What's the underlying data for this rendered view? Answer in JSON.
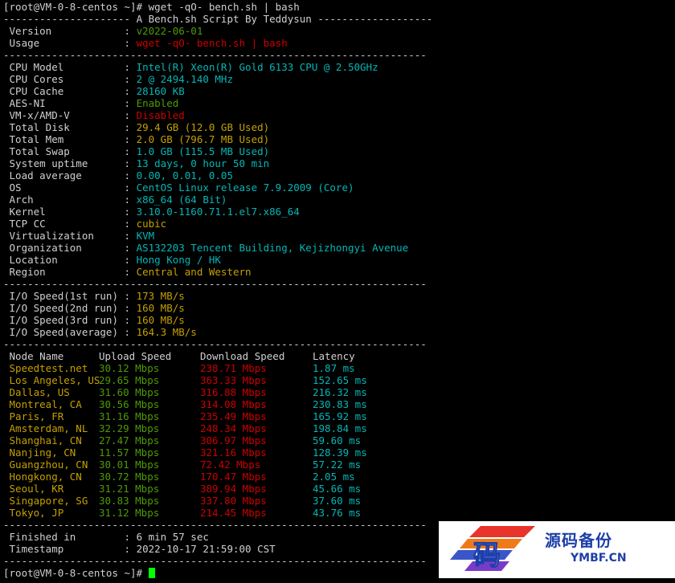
{
  "prompt_cmd": "[root@VM-0-8-centos ~]# wget -qO- bench.sh | bash",
  "divider": "----------------------------------------------------------------------",
  "banner": "--------------------- A Bench.sh Script By Teddysun -------------------",
  "header": [
    {
      "key": " Version            ",
      "sep": ": ",
      "value": "v2022-06-01",
      "color": "g"
    },
    {
      "key": " Usage              ",
      "sep": ": ",
      "value": "wget -qO- bench.sh | bash",
      "color": "r"
    }
  ],
  "sysinfo": [
    {
      "key": " CPU Model          ",
      "sep": ": ",
      "value": "Intel(R) Xeon(R) Gold 6133 CPU @ 2.50GHz",
      "color": "c"
    },
    {
      "key": " CPU Cores          ",
      "sep": ": ",
      "value": "2 @ 2494.140 MHz",
      "color": "c"
    },
    {
      "key": " CPU Cache          ",
      "sep": ": ",
      "value": "28160 KB",
      "color": "c"
    },
    {
      "key": " AES-NI             ",
      "sep": ": ",
      "value": "Enabled",
      "color": "g"
    },
    {
      "key": " VM-x/AMD-V         ",
      "sep": ": ",
      "value": "Disabled",
      "color": "r"
    },
    {
      "key": " Total Disk         ",
      "sep": ": ",
      "value": "29.4 GB (12.0 GB Used)",
      "color": "y"
    },
    {
      "key": " Total Mem          ",
      "sep": ": ",
      "value": "2.0 GB (796.7 MB Used)",
      "color": "y"
    },
    {
      "key": " Total Swap         ",
      "sep": ": ",
      "value": "1.0 GB (115.5 MB Used)",
      "color": "c"
    },
    {
      "key": " System uptime      ",
      "sep": ": ",
      "value": "13 days, 0 hour 50 min",
      "color": "c"
    },
    {
      "key": " Load average       ",
      "sep": ": ",
      "value": "0.00, 0.01, 0.05",
      "color": "c"
    },
    {
      "key": " OS                 ",
      "sep": ": ",
      "value": "CentOS Linux release 7.9.2009 (Core)",
      "color": "c"
    },
    {
      "key": " Arch               ",
      "sep": ": ",
      "value": "x86_64 (64 Bit)",
      "color": "c"
    },
    {
      "key": " Kernel             ",
      "sep": ": ",
      "value": "3.10.0-1160.71.1.el7.x86_64",
      "color": "c"
    },
    {
      "key": " TCP CC             ",
      "sep": ": ",
      "value": "cubic",
      "color": "y"
    },
    {
      "key": " Virtualization     ",
      "sep": ": ",
      "value": "KVM",
      "color": "c"
    },
    {
      "key": " Organization       ",
      "sep": ": ",
      "value": "AS132203 Tencent Building, Kejizhongyi Avenue",
      "color": "c"
    },
    {
      "key": " Location           ",
      "sep": ": ",
      "value": "Hong Kong / HK",
      "color": "c"
    },
    {
      "key": " Region             ",
      "sep": ": ",
      "value": "Central and Western",
      "color": "y"
    }
  ],
  "io": [
    {
      "key": " I/O Speed(1st run) ",
      "sep": ": ",
      "value": "173 MB/s",
      "color": "y"
    },
    {
      "key": " I/O Speed(2nd run) ",
      "sep": ": ",
      "value": "160 MB/s",
      "color": "y"
    },
    {
      "key": " I/O Speed(3rd run) ",
      "sep": ": ",
      "value": "160 MB/s",
      "color": "y"
    },
    {
      "key": " I/O Speed(average) ",
      "sep": ": ",
      "value": "164.3 MB/s",
      "color": "y"
    }
  ],
  "speed_header": {
    "node": " Node Name",
    "upload": "Upload Speed",
    "download": "Download Speed",
    "latency": "Latency"
  },
  "speed_rows": [
    {
      "node": " Speedtest.net",
      "upload": "30.12 Mbps",
      "download": "238.71 Mbps",
      "latency": "1.87 ms"
    },
    {
      "node": " Los Angeles, US",
      "upload": "29.65 Mbps",
      "download": "363.33 Mbps",
      "latency": "152.65 ms"
    },
    {
      "node": " Dallas, US",
      "upload": "31.60 Mbps",
      "download": "316.88 Mbps",
      "latency": "216.32 ms"
    },
    {
      "node": " Montreal, CA",
      "upload": "30.56 Mbps",
      "download": "314.08 Mbps",
      "latency": "230.83 ms"
    },
    {
      "node": " Paris, FR",
      "upload": "31.16 Mbps",
      "download": "235.49 Mbps",
      "latency": "165.92 ms"
    },
    {
      "node": " Amsterdam, NL",
      "upload": "32.29 Mbps",
      "download": "248.34 Mbps",
      "latency": "198.84 ms"
    },
    {
      "node": " Shanghai, CN",
      "upload": "27.47 Mbps",
      "download": "306.97 Mbps",
      "latency": "59.60 ms"
    },
    {
      "node": " Nanjing, CN",
      "upload": "11.57 Mbps",
      "download": "321.16 Mbps",
      "latency": "128.39 ms"
    },
    {
      "node": " Guangzhou, CN",
      "upload": "30.01 Mbps",
      "download": "72.42 Mbps",
      "latency": "57.22 ms"
    },
    {
      "node": " Hongkong, CN",
      "upload": "30.72 Mbps",
      "download": "170.47 Mbps",
      "latency": "2.05 ms"
    },
    {
      "node": " Seoul, KR",
      "upload": "31.21 Mbps",
      "download": "389.94 Mbps",
      "latency": "45.66 ms"
    },
    {
      "node": " Singapore, SG",
      "upload": "30.83 Mbps",
      "download": "337.80 Mbps",
      "latency": "37.60 ms"
    },
    {
      "node": " Tokyo, JP",
      "upload": "31.12 Mbps",
      "download": "214.45 Mbps",
      "latency": "43.76 ms"
    }
  ],
  "footer": [
    {
      "key": " Finished in        ",
      "sep": ": ",
      "value": "6 min 57 sec",
      "color": "w"
    },
    {
      "key": " Timestamp          ",
      "sep": ": ",
      "value": "2022-10-17 21:59:00 CST",
      "color": "w"
    }
  ],
  "final_prompt": "[root@VM-0-8-centos ~]# ",
  "colors": {
    "green": "#4e9a06",
    "red": "#cc0000",
    "yellow": "#c4a000",
    "cyan": "#06b5b5",
    "cursor": "#00ff00"
  },
  "watermark": {
    "logo_char": "码",
    "cn": "源码备份",
    "en": "YMBF.CN"
  }
}
